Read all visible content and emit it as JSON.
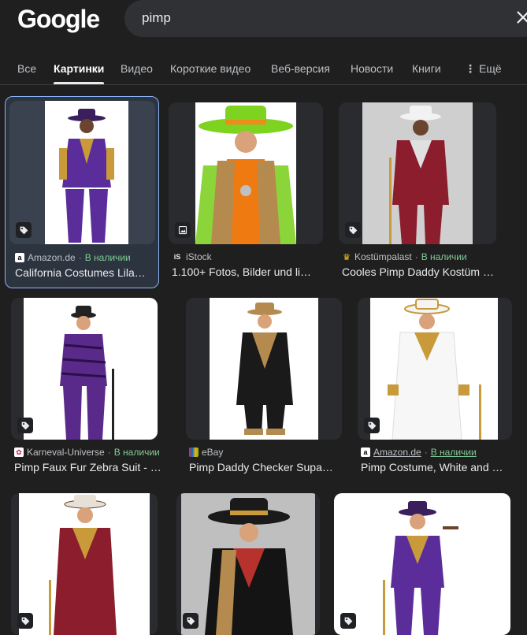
{
  "logo": "Google",
  "search": {
    "query": "pimp"
  },
  "tabs": [
    {
      "label": "Все"
    },
    {
      "label": "Картинки"
    },
    {
      "label": "Видео"
    },
    {
      "label": "Короткие видео"
    },
    {
      "label": "Веб-версия"
    },
    {
      "label": "Новости"
    },
    {
      "label": "Книги"
    },
    {
      "label": "Ещё"
    }
  ],
  "stock_label": "В наличии",
  "results": [
    {
      "source": "Amazon.de",
      "title": "California Costumes Lila…",
      "in_stock": true,
      "badge": "tag-icon"
    },
    {
      "source": "iStock",
      "title": "1.100+ Fotos, Bilder und li…",
      "in_stock": false,
      "badge": "image-icon"
    },
    {
      "source": "Kostümpalast",
      "title": "Cooles Pimp Daddy Kostüm b…",
      "in_stock": true,
      "badge": "tag-icon"
    },
    {
      "source": "Karneval-Universe",
      "title": "Pimp Faux Fur Zebra Suit - …",
      "in_stock": true,
      "badge": "tag-icon"
    },
    {
      "source": "eBay",
      "title": "Pimp Daddy Checker Supa…",
      "in_stock": false,
      "badge": "none"
    },
    {
      "source": "Amazon.de",
      "title": "Pimp Costume, White and …",
      "in_stock": true,
      "badge": "tag-icon"
    }
  ],
  "colors": {
    "accent": "#8ab4f8",
    "stock": "#81c995",
    "background": "#1f1f1f"
  }
}
